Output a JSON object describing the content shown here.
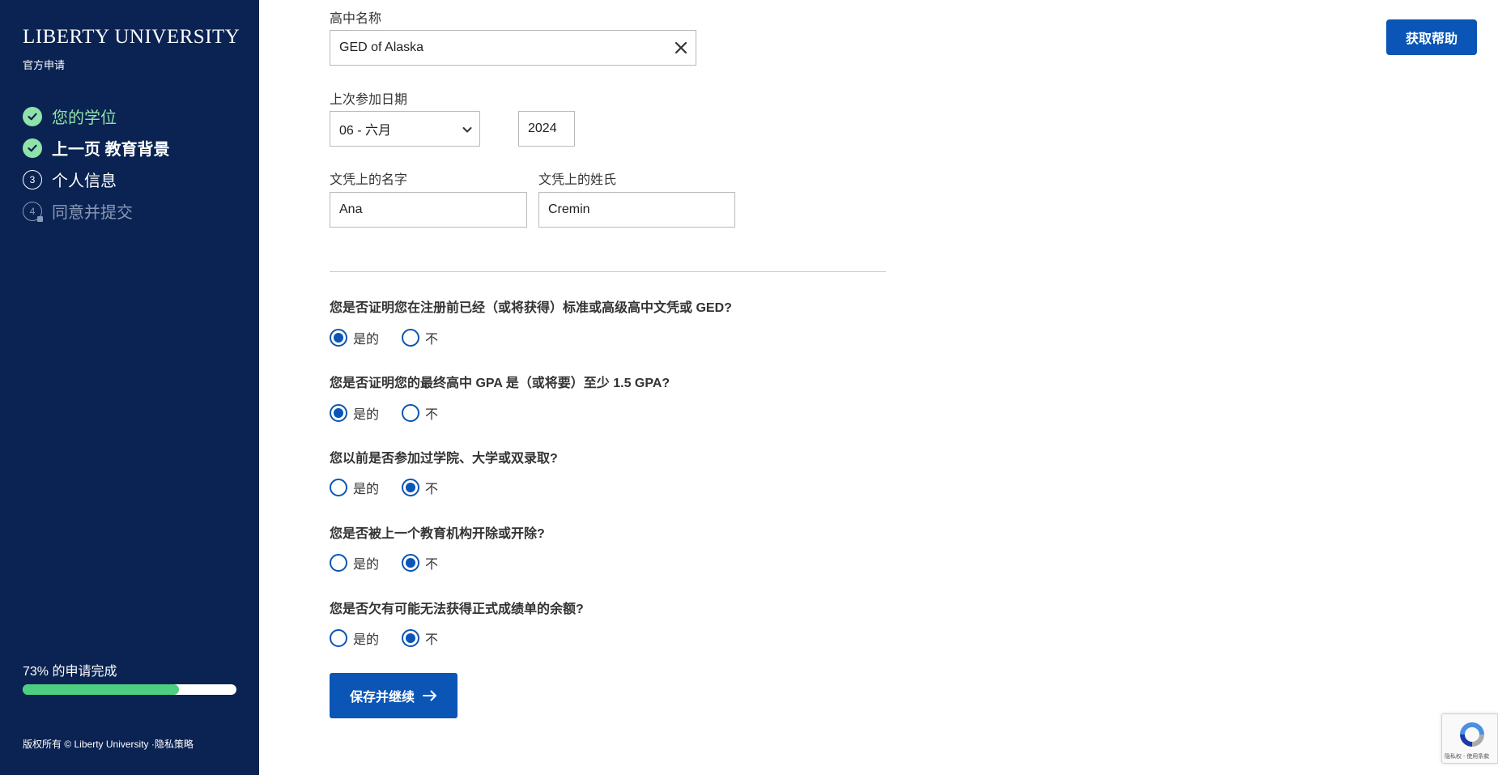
{
  "sidebar": {
    "brand": "LIBERTY UNIVERSITY",
    "subtitle": "官方申请",
    "steps": [
      {
        "label": "您的学位",
        "state": "complete",
        "icon": "check-icon"
      },
      {
        "label": "上一页 教育背景",
        "state": "complete",
        "icon": "check-icon"
      },
      {
        "number": "3",
        "label": "个人信息",
        "state": "current"
      },
      {
        "number": "4",
        "label": "同意并提交",
        "state": "locked",
        "icon": "lock-icon"
      }
    ],
    "progress": {
      "text": "73% 的申请完成",
      "percent": 73
    },
    "footer": "版权所有 © Liberty University ·隐私策略"
  },
  "header": {
    "help_label": "获取帮助"
  },
  "form": {
    "school_label": "高中名称",
    "school_value": "GED of Alaska",
    "date_label": "上次参加日期",
    "month_value": "06 - 六月",
    "year_value": "2024",
    "first_name_label": "文凭上的名字",
    "first_name_value": "Ana",
    "last_name_label": "文凭上的姓氏",
    "last_name_value": "Cremin",
    "yes_label": "是的",
    "no_label": "不",
    "questions": [
      {
        "text": "您是否证明您在注册前已经（或将获得）标准或高级高中文凭或 GED?",
        "selected": "yes"
      },
      {
        "text": "您是否证明您的最终高中 GPA 是（或将要）至少 1.5 GPA?",
        "selected": "yes"
      },
      {
        "text": "您以前是否参加过学院、大学或双录取?",
        "selected": "no"
      },
      {
        "text": "您是否被上一个教育机构开除或开除?",
        "selected": "no"
      },
      {
        "text": "您是否欠有可能无法获得正式成绩单的余额?",
        "selected": "no"
      }
    ],
    "save_label": "保存并继续"
  },
  "recaptcha": {
    "text": "隐私权 - 使用条款"
  },
  "colors": {
    "sidebar_bg": "#0a2352",
    "accent": "#0a55b5",
    "success": "#8fe3a8",
    "progress": "#4ccf80"
  }
}
